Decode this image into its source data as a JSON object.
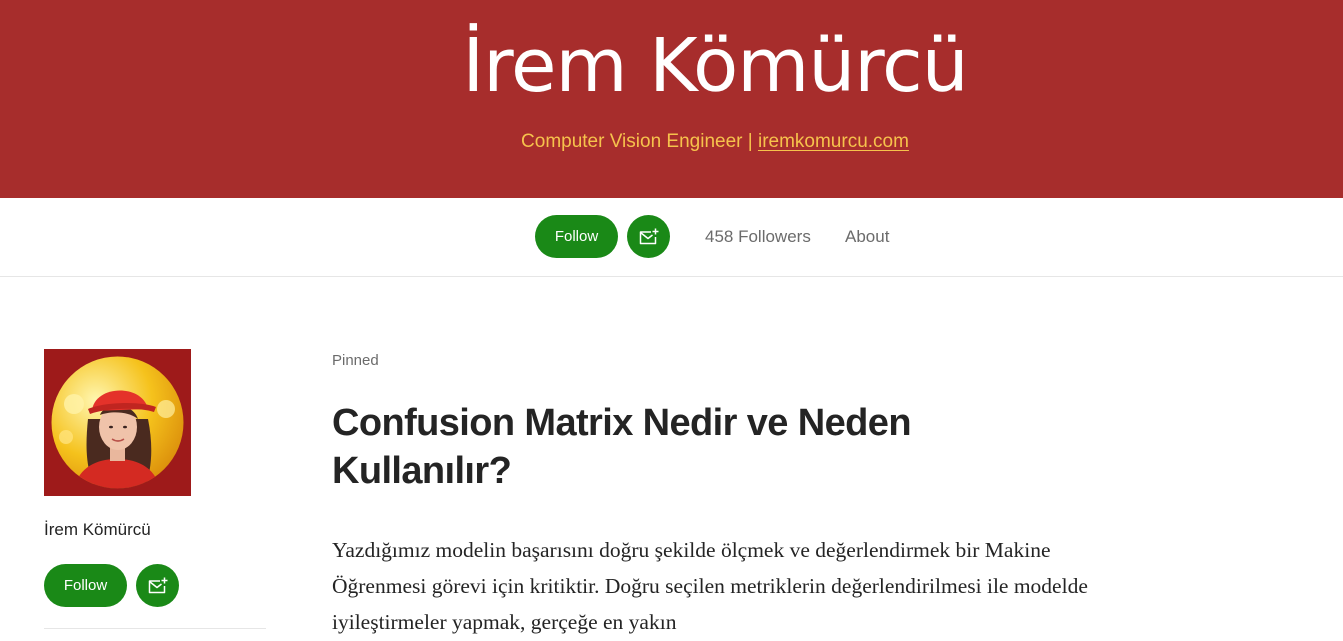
{
  "banner": {
    "title": "İrem Kömürcü",
    "subtitle_prefix": "Computer Vision Engineer | ",
    "subtitle_link": "iremkomurcu.com",
    "background_color": "#a72d2c",
    "subtitle_color": "#f6c24c"
  },
  "nav": {
    "follow_label": "Follow",
    "subscribe_icon": "mail-plus-icon",
    "followers_label": "458 Followers",
    "about_label": "About",
    "accent_color": "#1a8917"
  },
  "sidebar": {
    "avatar_icon": "profile-photo",
    "name": "İrem Kömürcü",
    "follow_label": "Follow",
    "subscribe_icon": "mail-plus-icon"
  },
  "post": {
    "pinned_label": "Pinned",
    "title": "Confusion Matrix Nedir ve Neden Kullanılır?",
    "excerpt": "Yazdığımız modelin başarısını doğru şekilde ölçmek ve değerlendirmek bir Makine Öğrenmesi görevi için kritiktir. Doğru seçilen metriklerin değerlendirilmesi ile modelde iyileştirmeler yapmak, gerçeğe en yakın"
  }
}
